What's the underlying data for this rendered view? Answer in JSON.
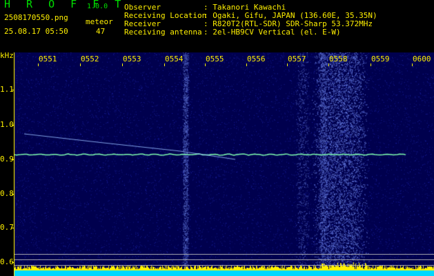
{
  "app": {
    "name": "H R O F F T",
    "version": "1.0.0"
  },
  "file": {
    "name": "2508170550.png",
    "datetime": "25.08.17 05:50"
  },
  "meteor": {
    "label": "meteor",
    "count": "47"
  },
  "info": [
    {
      "key": "Observer",
      "value": ": Takanori Kawachi"
    },
    {
      "key": "Receiving Location",
      "value": ": Ogaki, Gifu, JAPAN (136.60E, 35.35N)"
    },
    {
      "key": "Receiver",
      "value": ": R820T2(RTL-SDR) SDR-Sharp 53.372MHz"
    },
    {
      "key": "Receiving antenna",
      "value": ": 2el-HB9CV Vertical (el. E-W)"
    }
  ],
  "axis": {
    "y_unit": "kHz",
    "y_ticks": [
      "1.1",
      "1.0",
      "0.9",
      "0.8",
      "0.7",
      "0.6"
    ],
    "x_ticks": [
      "0551",
      "0552",
      "0553",
      "0554",
      "0555",
      "0556",
      "0557",
      "0558",
      "0559",
      "0600"
    ]
  },
  "colors": {
    "text": "#fff000",
    "logo": "#00e000",
    "background": "#000000",
    "plot": "#00005a",
    "carrier": "#7fffb0"
  }
}
